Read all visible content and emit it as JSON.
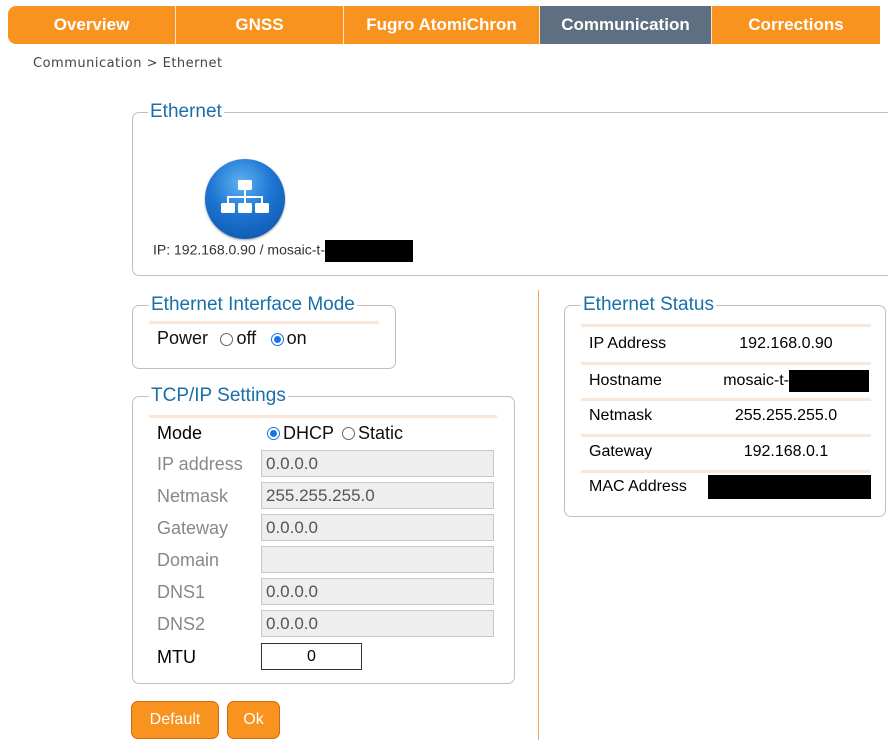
{
  "nav": {
    "tabs": [
      {
        "label": "Overview"
      },
      {
        "label": "GNSS"
      },
      {
        "label": "Fugro AtomiChron"
      },
      {
        "label": "Communication"
      },
      {
        "label": "Corrections"
      }
    ]
  },
  "breadcrumb": "Communication > Ethernet",
  "ethernet": {
    "legend": "Ethernet",
    "icon": "network-icon",
    "ip_line": "IP: 192.168.0.90 / mosaic-t-"
  },
  "interface_mode": {
    "legend": "Ethernet Interface Mode",
    "power_label": "Power",
    "off_label": "off",
    "on_label": "on",
    "selected": "on"
  },
  "tcpip": {
    "legend": "TCP/IP Settings",
    "mode_label": "Mode",
    "dhcp_label": "DHCP",
    "static_label": "Static",
    "selected_mode": "DHCP",
    "fields": {
      "ip_label": "IP address",
      "ip_value": "0.0.0.0",
      "netmask_label": "Netmask",
      "netmask_value": "255.255.255.0",
      "gateway_label": "Gateway",
      "gateway_value": "0.0.0.0",
      "domain_label": "Domain",
      "domain_value": "",
      "dns1_label": "DNS1",
      "dns1_value": "0.0.0.0",
      "dns2_label": "DNS2",
      "dns2_value": "0.0.0.0",
      "mtu_label": "MTU",
      "mtu_value": "0"
    }
  },
  "buttons": {
    "default_label": "Default",
    "ok_label": "Ok"
  },
  "status": {
    "legend": "Ethernet Status",
    "rows": [
      {
        "label": "IP Address",
        "value": "192.168.0.90"
      },
      {
        "label": "Hostname",
        "value": "mosaic-t-"
      },
      {
        "label": "Netmask",
        "value": "255.255.255.0"
      },
      {
        "label": "Gateway",
        "value": "192.168.0.1"
      },
      {
        "label": "MAC Address",
        "value": ""
      }
    ]
  },
  "colors": {
    "accent": "#f7931e",
    "active_tab": "#5d6f80",
    "legend": "#1a6fa8"
  }
}
